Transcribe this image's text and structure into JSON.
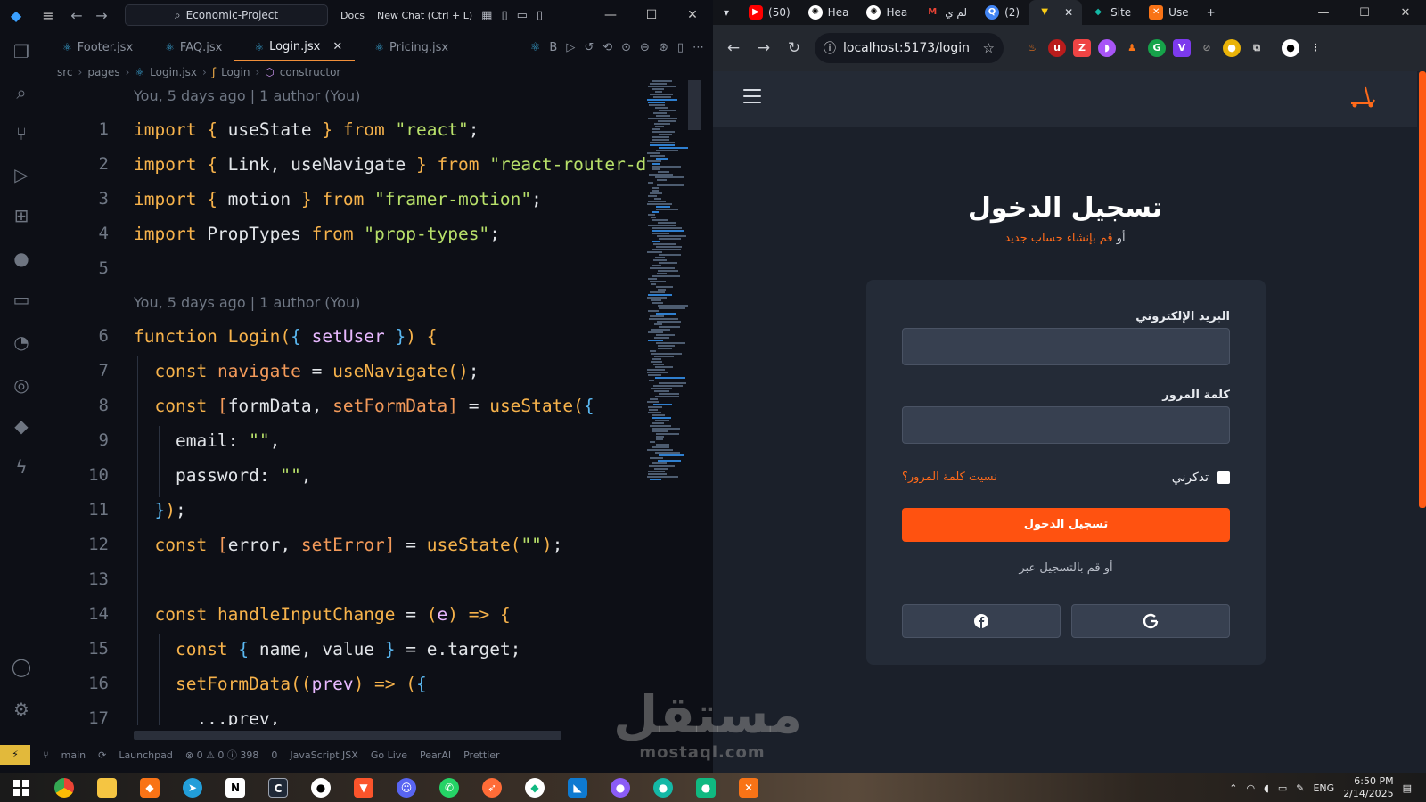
{
  "vscode": {
    "search_text": "Economic-Project",
    "docs_label": "Docs",
    "new_chat_label": "New Chat (Ctrl + L)",
    "tabs": [
      {
        "label": "Footer.jsx"
      },
      {
        "label": "FAQ.jsx"
      },
      {
        "label": "Login.jsx"
      },
      {
        "label": "Pricing.jsx"
      }
    ],
    "tab_overflow_label": "B",
    "breadcrumb": [
      "src",
      "pages",
      "Login.jsx",
      "Login",
      "constructor"
    ],
    "codelens": "You, 5 days ago | 1 author (You)",
    "line_numbers": [
      "1",
      "2",
      "3",
      "4",
      "5",
      "6",
      "7",
      "8",
      "9",
      "10",
      "11",
      "12",
      "13",
      "14",
      "15",
      "16",
      "17"
    ],
    "status": {
      "branch": "main",
      "launchpad": "Launchpad",
      "problems": "⊗ 0 ⚠ 0 ⓘ 398",
      "ports": "0",
      "language": "JavaScript JSX",
      "golive": "Go Live",
      "pearai": "PearAI",
      "prettier": "Prettier"
    }
  },
  "chrome": {
    "tabs": [
      {
        "label": "(50)",
        "icon": "youtube-icon",
        "color": "#ff0000"
      },
      {
        "label": "Hea",
        "icon": "openai-icon",
        "color": "#ffffff"
      },
      {
        "label": "Hea",
        "icon": "openai-icon",
        "color": "#ffffff"
      },
      {
        "label": "لم ي",
        "icon": "gmail-icon",
        "color": "#ea4335"
      },
      {
        "label": "(2)",
        "icon": "quillbot-icon",
        "color": "#4285f4"
      },
      {
        "label": "",
        "icon": "vite-icon",
        "color": "#a855f7"
      },
      {
        "label": "Site",
        "icon": "site-icon",
        "color": "#14b8a6"
      },
      {
        "label": "Use",
        "icon": "xampp-icon",
        "color": "#f97316"
      }
    ],
    "url": "localhost:5173/login"
  },
  "page": {
    "title": "تسجيل الدخول",
    "subtitle_prefix": "أو",
    "subtitle_link": "قم بإنشاء حساب جديد",
    "email_label": "البريد الإلكتروني",
    "password_label": "كلمة المرور",
    "remember_label": "تذكرني",
    "forgot_label": "نسيت كلمة المرور؟",
    "login_button": "تسجيل الدخول",
    "divider_text": "أو قم بالتسجيل عبر",
    "accent_color": "#ff5210"
  },
  "watermark": {
    "big": "مستقل",
    "small": "mostaql.com"
  },
  "taskbar": {
    "lang": "ENG",
    "time": "6:50 PM",
    "date": "2/14/2025"
  }
}
